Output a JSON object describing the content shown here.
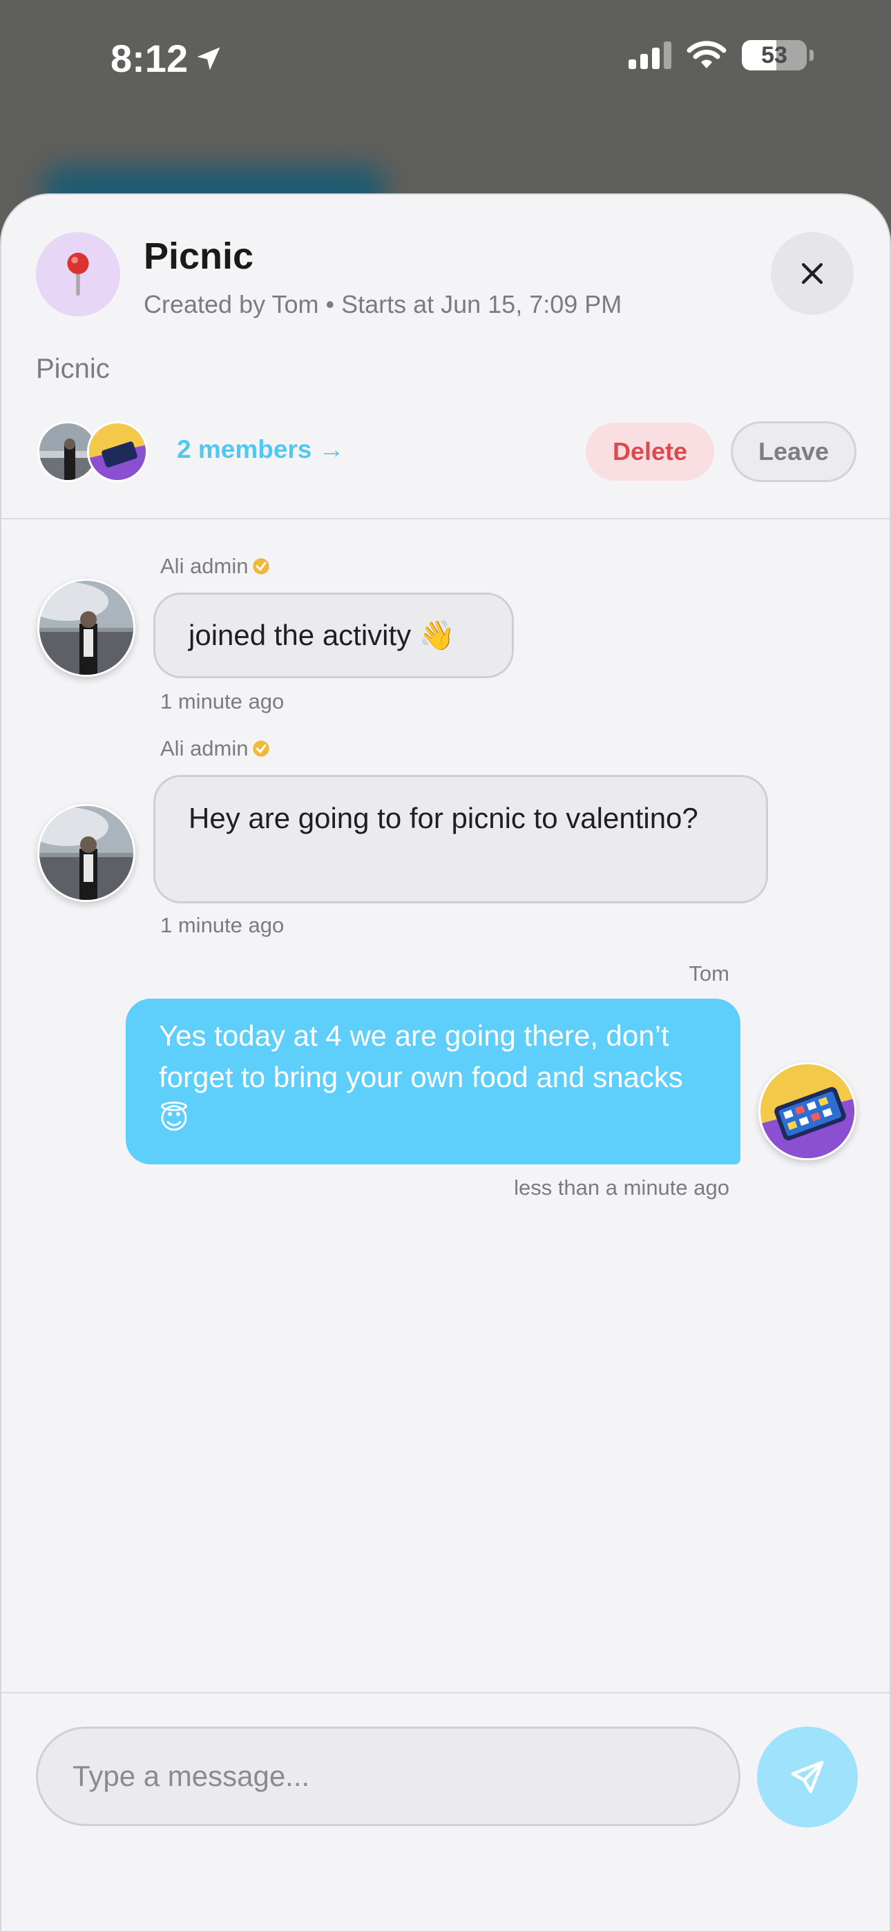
{
  "status_bar": {
    "time": "8:12",
    "battery": "53",
    "battery_level": 0.53,
    "icons": [
      "location-arrow-icon",
      "signal-icon",
      "wifi-icon",
      "battery-icon"
    ]
  },
  "activity": {
    "title": "Picnic",
    "subtitle": "Created by Tom • Starts at Jun 15, 7:09 PM",
    "description": "Picnic",
    "members_link": "2 members →",
    "delete_label": "Delete",
    "leave_label": "Leave",
    "icon": "pin-icon"
  },
  "messages": [
    {
      "sender": "Ali admin",
      "verified": true,
      "text": "joined the activity 👋",
      "time": "1 minute ago",
      "outgoing": false
    },
    {
      "sender": "Ali admin",
      "verified": true,
      "text": "Hey are going to for picnic to valentino?",
      "time": "1 minute ago",
      "outgoing": false
    },
    {
      "sender": "Tom",
      "verified": false,
      "text": "Yes today at 4 we are going there, don’t forget to bring your own food and snacks 😇",
      "time": "less than a minute ago",
      "outgoing": true
    }
  ],
  "composer": {
    "placeholder": "Type a message...",
    "send_icon": "send-icon"
  },
  "colors": {
    "accent": "#5ecffb",
    "delete": "#e0484d",
    "sheet_bg": "#f4f4f7"
  }
}
